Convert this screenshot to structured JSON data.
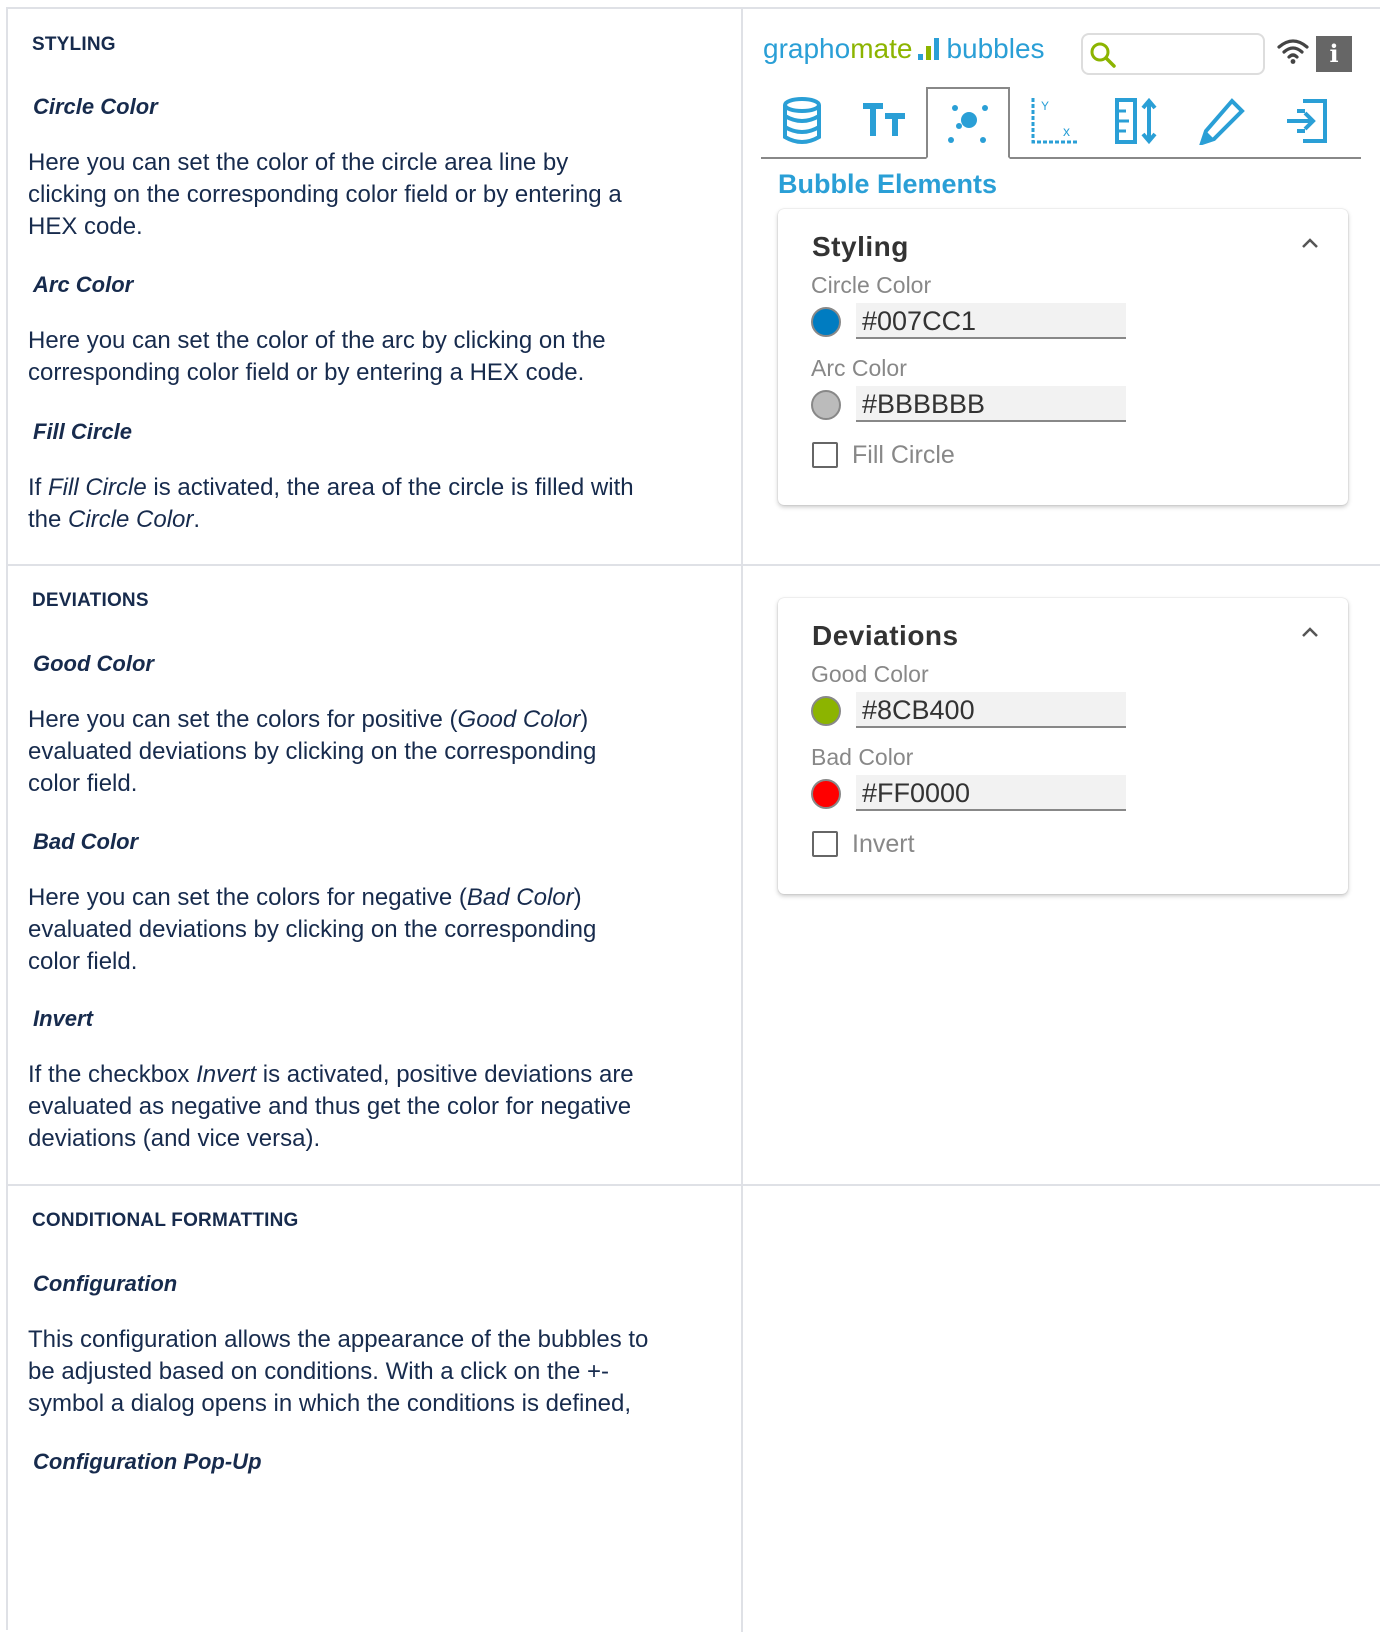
{
  "rows": [
    {
      "section": "STYLING",
      "items": [
        {
          "subheading": "Circle Color",
          "text": [
            "Here you can set the color of the circle area line by",
            "clicking on the corresponding color field or by entering a",
            "HEX code."
          ]
        },
        {
          "subheading": "Arc Color",
          "text": [
            "Here you can set the color of the arc by clicking on the",
            "corresponding color field or by entering a HEX code."
          ]
        },
        {
          "subheading": "Fill Circle",
          "text": [
            "If Fill Circle is activated, the area of the circle is filled with",
            "the Circle Color."
          ]
        }
      ]
    },
    {
      "section": "DEVIATIONS",
      "items": [
        {
          "subheading": "Good Color",
          "text": [
            "Here you can set the colors for positive (Good Color)",
            "evaluated deviations by clicking on the corresponding",
            "color field."
          ]
        },
        {
          "subheading": "Bad Color",
          "text": [
            "Here you can set the colors for negative (Bad Color)",
            "evaluated deviations by clicking on the corresponding",
            "color field."
          ]
        },
        {
          "subheading": "Invert",
          "text": [
            "If the checkbox Invert is activated, positive deviations are",
            "evaluated as negative and thus get the color for negative",
            "deviations (and vice versa)."
          ]
        }
      ]
    },
    {
      "section": "CONDITIONAL FORMATTING",
      "items": [
        {
          "subheading": "Configuration",
          "text": [
            "This configuration allows the appearance of the bubbles to",
            "be adjusted based on conditions. With a click on the +-",
            "symbol a dialog opens in which the conditions is defined,"
          ]
        },
        {
          "subheading": "Configuration Pop-Up",
          "text": []
        }
      ]
    }
  ],
  "panel": {
    "logo": {
      "part1": "grapho",
      "part2": "mate",
      "part3": "bubbles"
    },
    "search": {
      "placeholder": ""
    },
    "info_label": "i",
    "tabs": [
      "database-icon",
      "text-format-icon",
      "bubble-elements-icon",
      "axis-icon",
      "ruler-icon",
      "pencil-icon",
      "export-icon"
    ],
    "active_tab": 2,
    "section_title": "Bubble Elements",
    "styling_card": {
      "title": "Styling",
      "circle_color": {
        "label": "Circle Color",
        "value": "#007CC1",
        "color": "#007CC1"
      },
      "arc_color": {
        "label": "Arc Color",
        "value": "#BBBBBB",
        "color": "#BBBBBB"
      },
      "fill_circle": {
        "label": "Fill Circle",
        "checked": false
      }
    },
    "deviations_card": {
      "title": "Deviations",
      "good_color": {
        "label": "Good Color",
        "value": "#8CB400",
        "color": "#8CB400"
      },
      "bad_color": {
        "label": "Bad Color",
        "value": "#FF0000",
        "color": "#FF0000"
      },
      "invert": {
        "label": "Invert",
        "checked": false
      }
    }
  }
}
